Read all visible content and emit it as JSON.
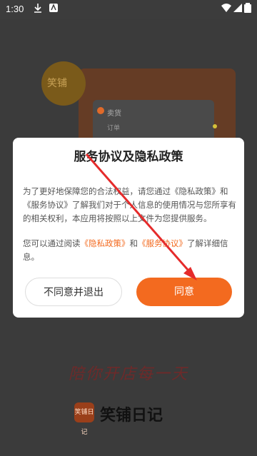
{
  "status_bar": {
    "time": "1:30"
  },
  "background": {
    "badge_text": "笑铺",
    "mini_title": "卖货",
    "mini_sub": "订单"
  },
  "dialog": {
    "title": "服务协议及隐私政策",
    "para1_part1": "为了更好地保障您的合法权益，请您通过",
    "para1_link1": "《隐私政策》",
    "para1_part2": "和",
    "para1_link2": "《服务协议》",
    "para1_part3": "了解我们对于个人信息的使用情况与您所享有的相关权利，本应用将按照以上文件为您提供服务。",
    "para2_part1": "您可以通过阅读",
    "para2_link1": "《隐私政策》",
    "para2_part2": "和",
    "para2_link2": "《服务协议》",
    "para2_part3": "了解详细信息。",
    "decline_label": "不同意并退出",
    "agree_label": "同意"
  },
  "slogan": "陪你开店每一天",
  "brand": {
    "logo_text": "笑铺日记",
    "name": "笑铺日记"
  },
  "colors": {
    "accent": "#f36a1f",
    "dim_background": "#3b3b3b",
    "arrow": "#e52b2b"
  }
}
